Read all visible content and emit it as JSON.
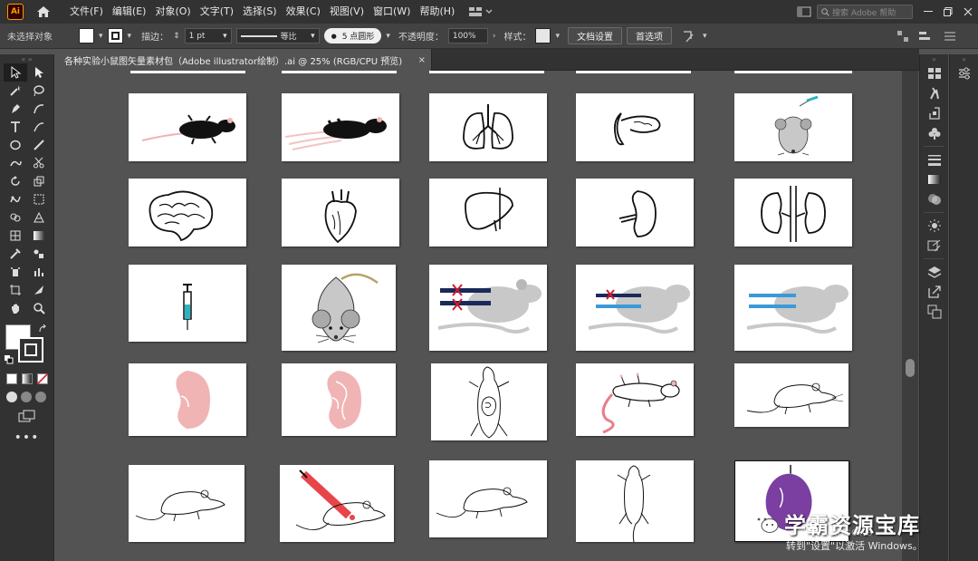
{
  "menubar": {
    "logo": "Ai",
    "menus": [
      "文件(F)",
      "编辑(E)",
      "对象(O)",
      "文字(T)",
      "选择(S)",
      "效果(C)",
      "视图(V)",
      "窗口(W)",
      "帮助(H)"
    ],
    "search_placeholder": "搜索 Adobe 帮助"
  },
  "controlbar": {
    "no_selection": "未选择对象",
    "stroke_label": "描边：",
    "stroke_value": "1 pt",
    "profile_label": "等比",
    "brush_dot": "●",
    "brush_label": "5 点圆形",
    "opacity_label": "不透明度：",
    "opacity_value": "100%",
    "style_label": "样式：",
    "doc_setup": "文档设置",
    "preferences": "首选项"
  },
  "tab": {
    "title": "各种实验小鼠图矢量素材包（Adobe illustrator绘制）.ai @ 25% (RGB/CPU 预览)",
    "close": "×"
  },
  "watermark": {
    "text": "学霸资源宝库"
  },
  "activation": {
    "ghost": "激活 Windows",
    "text": "转到\"设置\"以激活 Windows。"
  },
  "colors": {
    "mouse_grey": "#c8c8c8",
    "syringe_teal": "#2bb3c0",
    "organ_pink": "#f0b4b4",
    "navy": "#1a2a5a",
    "blue_bar": "#3a9ad9",
    "red_x": "#d01c2a",
    "purple": "#7a3fa0",
    "needle_red": "#e8454a"
  },
  "thumbnails": [
    {
      "icon": "dead-black-mouse-icon"
    },
    {
      "icon": "motion-black-mouse-icon"
    },
    {
      "icon": "lungs-icon"
    },
    {
      "icon": "stomach-pancreas-icon"
    },
    {
      "icon": "grey-mouse-syringe-icon"
    },
    {
      "icon": "brain-icon"
    },
    {
      "icon": "heart-icon"
    },
    {
      "icon": "liver-icon"
    },
    {
      "icon": "kidney-half-icon"
    },
    {
      "icon": "kidneys-icon"
    },
    {
      "icon": "syringe-icon"
    },
    {
      "icon": "grey-mouse-front-icon"
    },
    {
      "icon": "mouse-red-x-icon"
    },
    {
      "icon": "mouse-one-x-icon"
    },
    {
      "icon": "mouse-blue-bars-icon"
    },
    {
      "icon": "pink-kidney-icon"
    },
    {
      "icon": "pink-kidney-section-icon"
    },
    {
      "icon": "dissected-mouse-icon"
    },
    {
      "icon": "supine-mouse-icon"
    },
    {
      "icon": "outline-mouse-icon"
    },
    {
      "icon": "outline-mouse-2-icon"
    },
    {
      "icon": "mouse-injection-icon"
    },
    {
      "icon": "outline-mouse-3-icon"
    },
    {
      "icon": "mouse-top-view-icon"
    },
    {
      "icon": "purple-organ-icon"
    }
  ]
}
